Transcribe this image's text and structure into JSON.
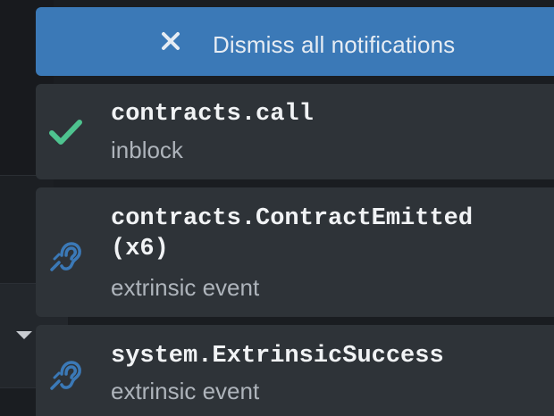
{
  "dismiss": {
    "label": "Dismiss all notifications",
    "icon": "close-icon"
  },
  "notifications": [
    {
      "icon": "checkmark-icon",
      "icon_color": "#4ec38f",
      "title": "contracts.call",
      "subtitle": "inblock"
    },
    {
      "icon": "ear-listen-icon",
      "icon_color": "#3b79b7",
      "title": "contracts.ContractEmitted\n(x6)",
      "subtitle": "extrinsic event"
    },
    {
      "icon": "ear-listen-icon",
      "icon_color": "#3b79b7",
      "title": "system.ExtrinsicSuccess",
      "subtitle": "extrinsic event"
    }
  ],
  "colors": {
    "dismiss_bg": "#3b79b7",
    "card_bg": "#2e3338",
    "page_bg": "#1a1d21"
  }
}
